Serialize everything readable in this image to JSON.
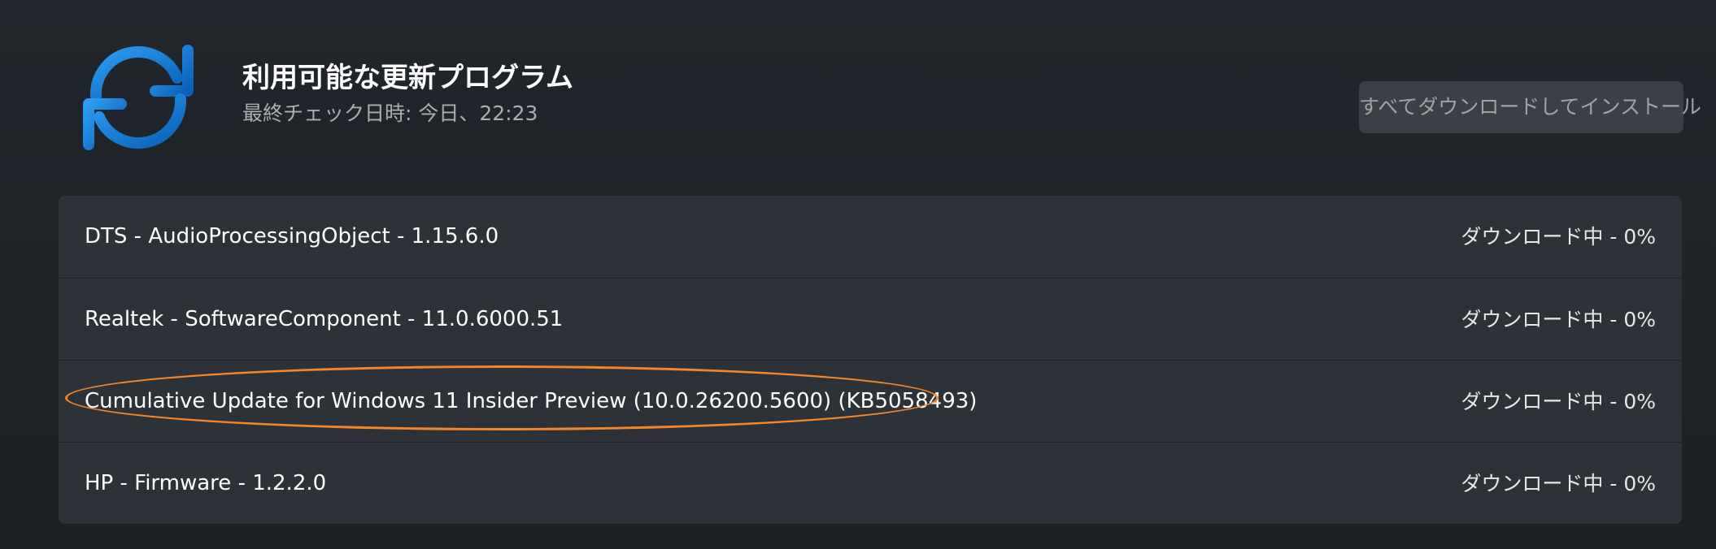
{
  "header": {
    "title": "利用可能な更新プログラム",
    "last_checked": "最終チェック日時: 今日、22:23",
    "icon": "refresh-icon",
    "icon_color": "#0f78d4"
  },
  "toolbar": {
    "install_all_label": "すべてダウンロードしてインストール"
  },
  "updates": [
    {
      "name": "DTS - AudioProcessingObject - 1.15.6.0",
      "status": "ダウンロード中 - 0%"
    },
    {
      "name": "Realtek - SoftwareComponent - 11.0.6000.51",
      "status": "ダウンロード中 - 0%"
    },
    {
      "name": "Cumulative Update for Windows 11 Insider Preview (10.0.26200.5600) (KB5058493)",
      "status": "ダウンロード中 - 0%"
    },
    {
      "name": "HP - Firmware - 1.2.2.0",
      "status": "ダウンロード中 - 0%"
    }
  ],
  "annotation": {
    "highlight_color": "#f5852b"
  }
}
